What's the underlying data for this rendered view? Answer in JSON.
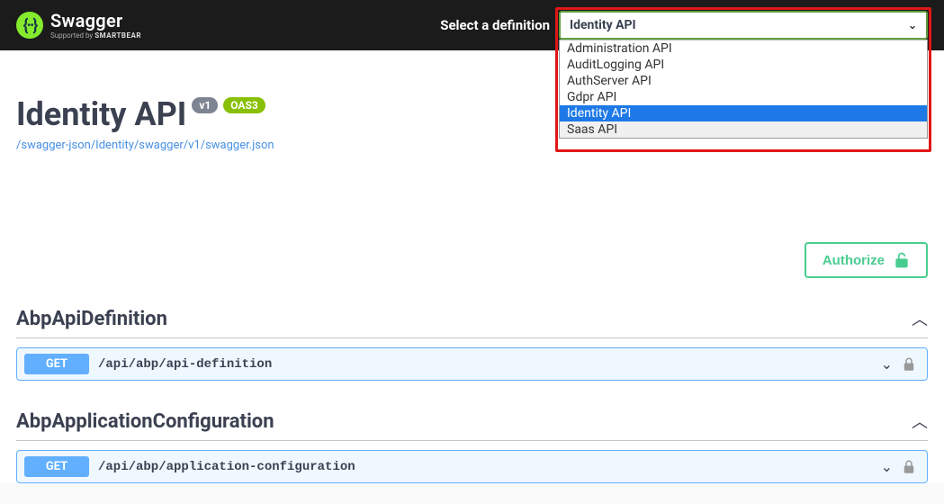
{
  "header": {
    "brand_main": "Swagger",
    "brand_sub_prefix": "Supported by ",
    "brand_sub_bold": "SMARTBEAR",
    "select_label": "Select a definition",
    "selected_value": "Identity API",
    "options": [
      "Administration API",
      "AuditLogging API",
      "AuthServer API",
      "Gdpr API",
      "Identity API",
      "Saas API"
    ],
    "selected_index": 4
  },
  "info": {
    "title": "Identity API",
    "version_badge": "v1",
    "oas_badge": "OAS3",
    "spec_link": "/swagger-json/Identity/swagger/v1/swagger.json"
  },
  "authorize": {
    "label": "Authorize"
  },
  "tags": [
    {
      "name": "AbpApiDefinition",
      "operations": [
        {
          "method": "GET",
          "path": "/api/abp/api-definition"
        }
      ]
    },
    {
      "name": "AbpApplicationConfiguration",
      "operations": [
        {
          "method": "GET",
          "path": "/api/abp/application-configuration"
        }
      ]
    }
  ]
}
